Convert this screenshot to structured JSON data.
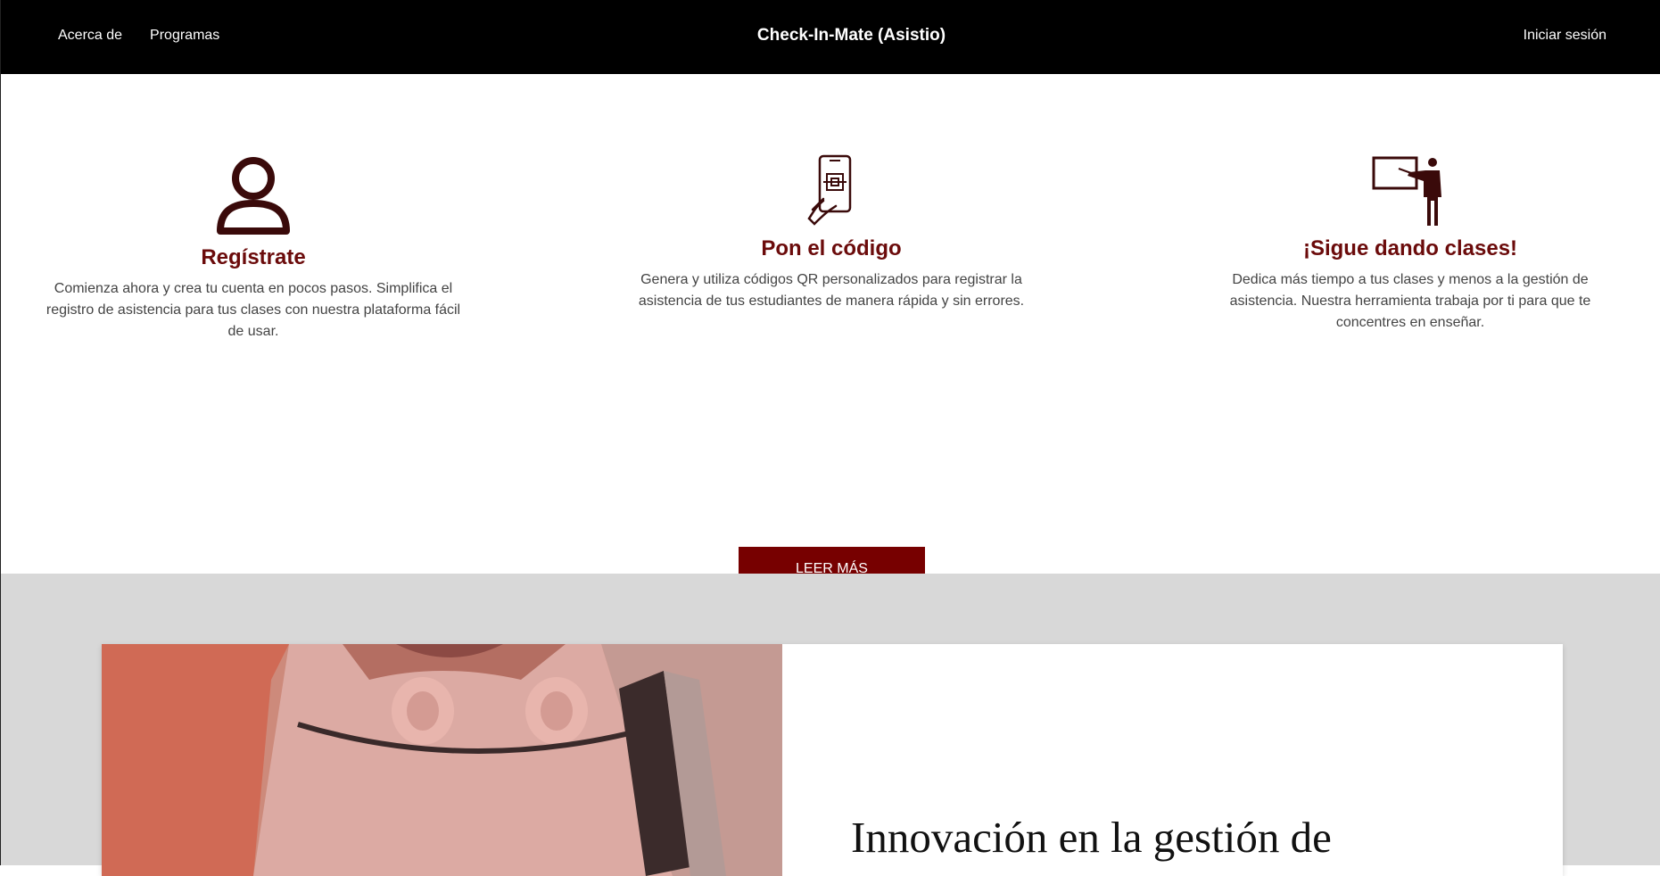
{
  "header": {
    "nav": [
      "Acerca de",
      "Programas"
    ],
    "brand": "Check-In-Mate (Asistio)",
    "login": "Iniciar sesión"
  },
  "features": [
    {
      "icon": "user-icon",
      "title": "Regístrate",
      "text": "Comienza ahora y crea tu cuenta en pocos pasos. Simplifica el registro de asistencia para tus clases con nuestra plataforma fácil de usar."
    },
    {
      "icon": "phone-qr-icon",
      "title": "Pon el código",
      "text": "Genera y utiliza códigos QR personalizados para registrar la asistencia de tus estudiantes de manera rápida y sin errores."
    },
    {
      "icon": "teacher-board-icon",
      "title": "¡Sigue dando clases!",
      "text": "Dedica más tiempo a tus clases y menos a la gestión de asistencia. Nuestra herramienta trabaja por ti para que te concentres en enseñar."
    }
  ],
  "cta": {
    "label": "LEER MÁS"
  },
  "showcase": {
    "title": "Innovación en la gestión de"
  },
  "colors": {
    "accent": "#770000",
    "title": "#6b0b0b",
    "header_bg": "#000000",
    "section_bg": "#d8d8d8"
  }
}
